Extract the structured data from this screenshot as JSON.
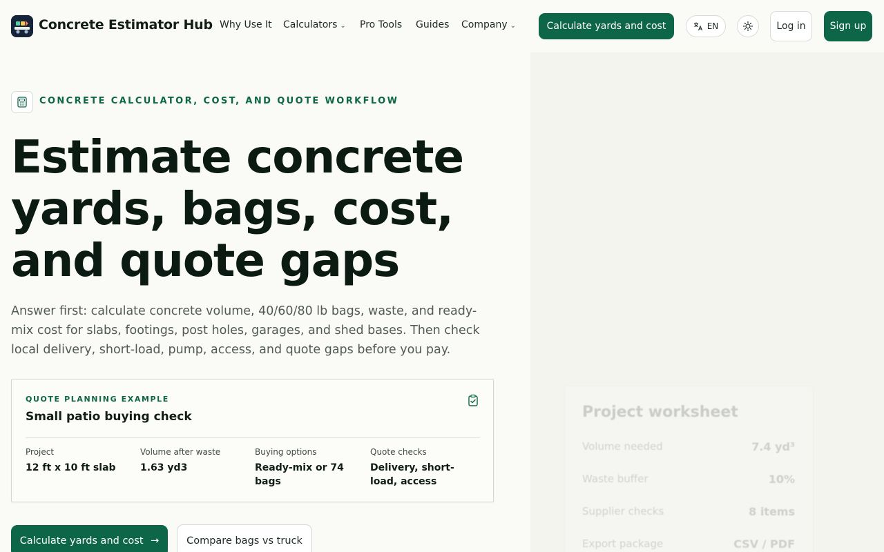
{
  "brand": {
    "name": "Concrete Estimator Hub"
  },
  "nav": [
    {
      "label": "Why Use It",
      "has_dropdown": false
    },
    {
      "label": "Calculators",
      "has_dropdown": true
    },
    {
      "label": "Pro Tools",
      "has_dropdown": false
    },
    {
      "label": "Guides",
      "has_dropdown": false
    },
    {
      "label": "Company",
      "has_dropdown": true
    }
  ],
  "header": {
    "cta_label": "Calculate yards and cost",
    "language": "EN",
    "login_label": "Log in",
    "signup_label": "Sign up"
  },
  "hero": {
    "eyebrow": "CONCRETE CALCULATOR, COST, AND QUOTE WORKFLOW",
    "title_lines": [
      "Estimate concrete",
      "yards, bags, cost,",
      "and quote gaps"
    ],
    "subtitle": "Answer first: calculate concrete volume, 40/60/80 lb bags, waste, and ready-mix cost for slabs, footings, post holes, garages, and shed bases. Then check local delivery, short-load, pump, access, and quote gaps before you pay."
  },
  "card": {
    "eyebrow": "QUOTE PLANNING EXAMPLE",
    "title": "Small patio buying check",
    "columns": [
      {
        "label": "Project",
        "value": "12 ft x 10 ft slab"
      },
      {
        "label": "Volume after waste",
        "value": "1.63 yd3"
      },
      {
        "label": "Buying options",
        "value": "Ready-mix or 74 bags"
      },
      {
        "label": "Quote checks",
        "value": "Delivery, short-load, access"
      }
    ]
  },
  "buttons": {
    "primary": "Calculate yards and cost",
    "primary_arrow": "→",
    "secondary": "Compare bags vs truck"
  },
  "worksheet": {
    "title": "Project worksheet",
    "rows": [
      {
        "label": "Volume needed",
        "value": "7.4 yd³"
      },
      {
        "label": "Waste buffer",
        "value": "10%"
      },
      {
        "label": "Supplier checks",
        "value": "8 items"
      },
      {
        "label": "Export package",
        "value": "CSV / PDF"
      }
    ]
  },
  "colors": {
    "accent": "#0d6647",
    "background": "#fafaf6",
    "heading": "#0b1a12",
    "body_text": "#515a55"
  }
}
